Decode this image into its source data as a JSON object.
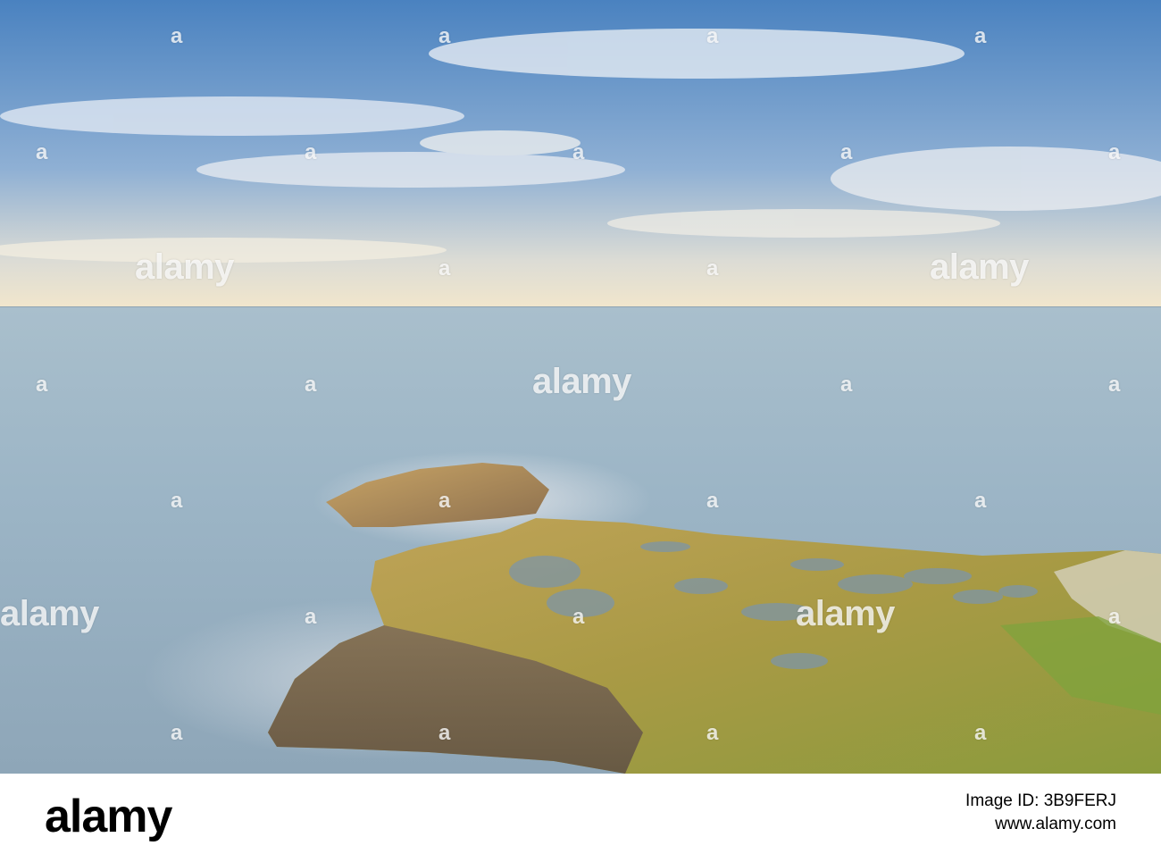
{
  "watermark": {
    "brand": "alamy",
    "glyph": "a"
  },
  "footer": {
    "logo": "alamy",
    "image_id_line": "Image ID: 3B9FERJ",
    "site_line": "www.alamy.com"
  },
  "colors": {
    "sky_top": "#4f86c2",
    "sky_horizon": "#f0e6cf",
    "sea": "#9db6c6",
    "rock_moss": "#a99a45",
    "rock_shadow": "#6e5a4a",
    "footer_bg": "#ffffff"
  }
}
